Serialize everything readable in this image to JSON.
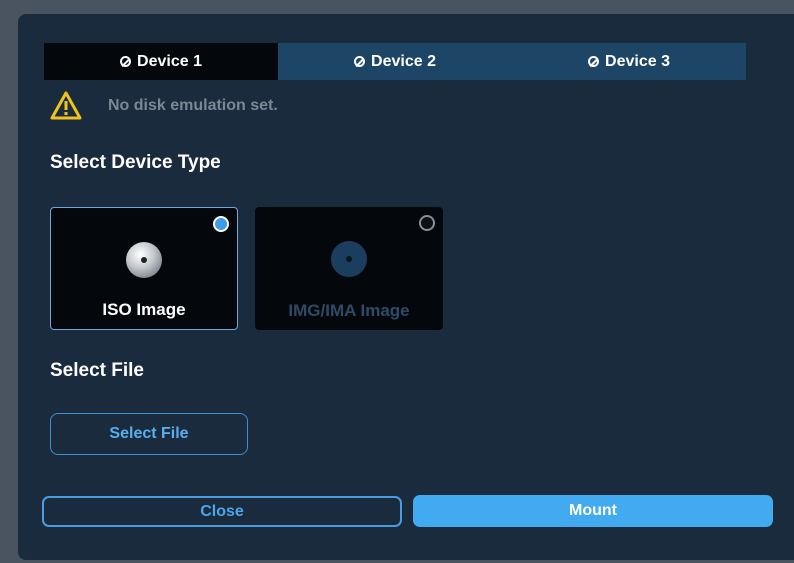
{
  "tabs": [
    {
      "label": "Device 1",
      "icon": "ban-icon",
      "active": true
    },
    {
      "label": "Device 2",
      "icon": "ban-icon",
      "active": false
    },
    {
      "label": "Device 3",
      "icon": "ban-icon",
      "active": false
    }
  ],
  "warning": {
    "icon": "warning-icon",
    "text": "No disk emulation set."
  },
  "device_type": {
    "heading": "Select Device Type",
    "options": [
      {
        "label": "ISO Image",
        "icon": "disc-icon",
        "selected": true
      },
      {
        "label": "IMG/IMA Image",
        "icon": "disc-icon",
        "selected": false
      }
    ]
  },
  "file": {
    "heading": "Select File",
    "button_label": "Select File"
  },
  "footer": {
    "close_label": "Close",
    "mount_label": "Mount"
  },
  "colors": {
    "dialog_bg": "#1a2b3e",
    "active_tab": "#04080d",
    "inactive_tab": "#1d4566",
    "accent": "#42aaf0",
    "warning": "#f0c419"
  }
}
